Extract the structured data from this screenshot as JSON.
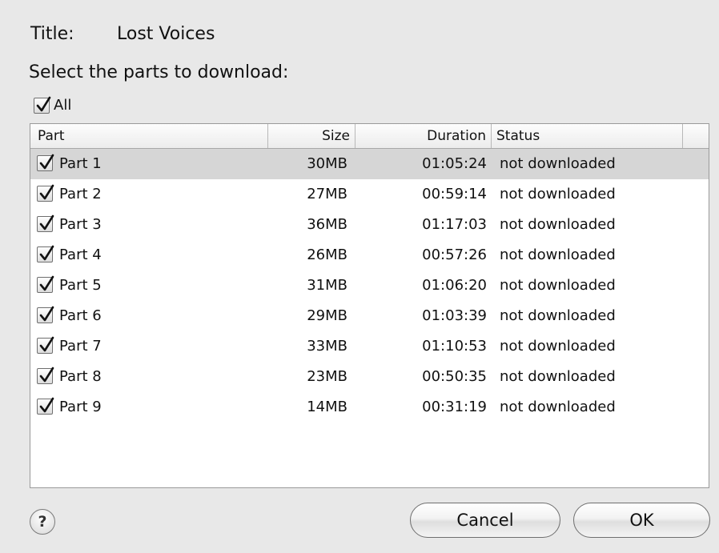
{
  "header": {
    "title_key": "Title:",
    "title_value": "Lost Voices",
    "instruction": "Select the parts to download:"
  },
  "select_all": {
    "label": "All",
    "checked": true
  },
  "table": {
    "columns": [
      "Part",
      "Size",
      "Duration",
      "Status"
    ],
    "selected_row": 0,
    "rows": [
      {
        "part": "Part 1",
        "size": "30MB",
        "duration": "01:05:24",
        "status": "not downloaded",
        "checked": true
      },
      {
        "part": "Part 2",
        "size": "27MB",
        "duration": "00:59:14",
        "status": "not downloaded",
        "checked": true
      },
      {
        "part": "Part 3",
        "size": "36MB",
        "duration": "01:17:03",
        "status": "not downloaded",
        "checked": true
      },
      {
        "part": "Part 4",
        "size": "26MB",
        "duration": "00:57:26",
        "status": "not downloaded",
        "checked": true
      },
      {
        "part": "Part 5",
        "size": "31MB",
        "duration": "01:06:20",
        "status": "not downloaded",
        "checked": true
      },
      {
        "part": "Part 6",
        "size": "29MB",
        "duration": "01:03:39",
        "status": "not downloaded",
        "checked": true
      },
      {
        "part": "Part 7",
        "size": "33MB",
        "duration": "01:10:53",
        "status": "not downloaded",
        "checked": true
      },
      {
        "part": "Part 8",
        "size": "23MB",
        "duration": "00:50:35",
        "status": "not downloaded",
        "checked": true
      },
      {
        "part": "Part 9",
        "size": "14MB",
        "duration": "00:31:19",
        "status": "not downloaded",
        "checked": true
      }
    ]
  },
  "footer": {
    "help_label": "?",
    "cancel_label": "Cancel",
    "ok_label": "OK"
  },
  "colors": {
    "background": "#e8e8e8",
    "selected_row": "#d6d6d6",
    "table_background": "#ffffff"
  }
}
